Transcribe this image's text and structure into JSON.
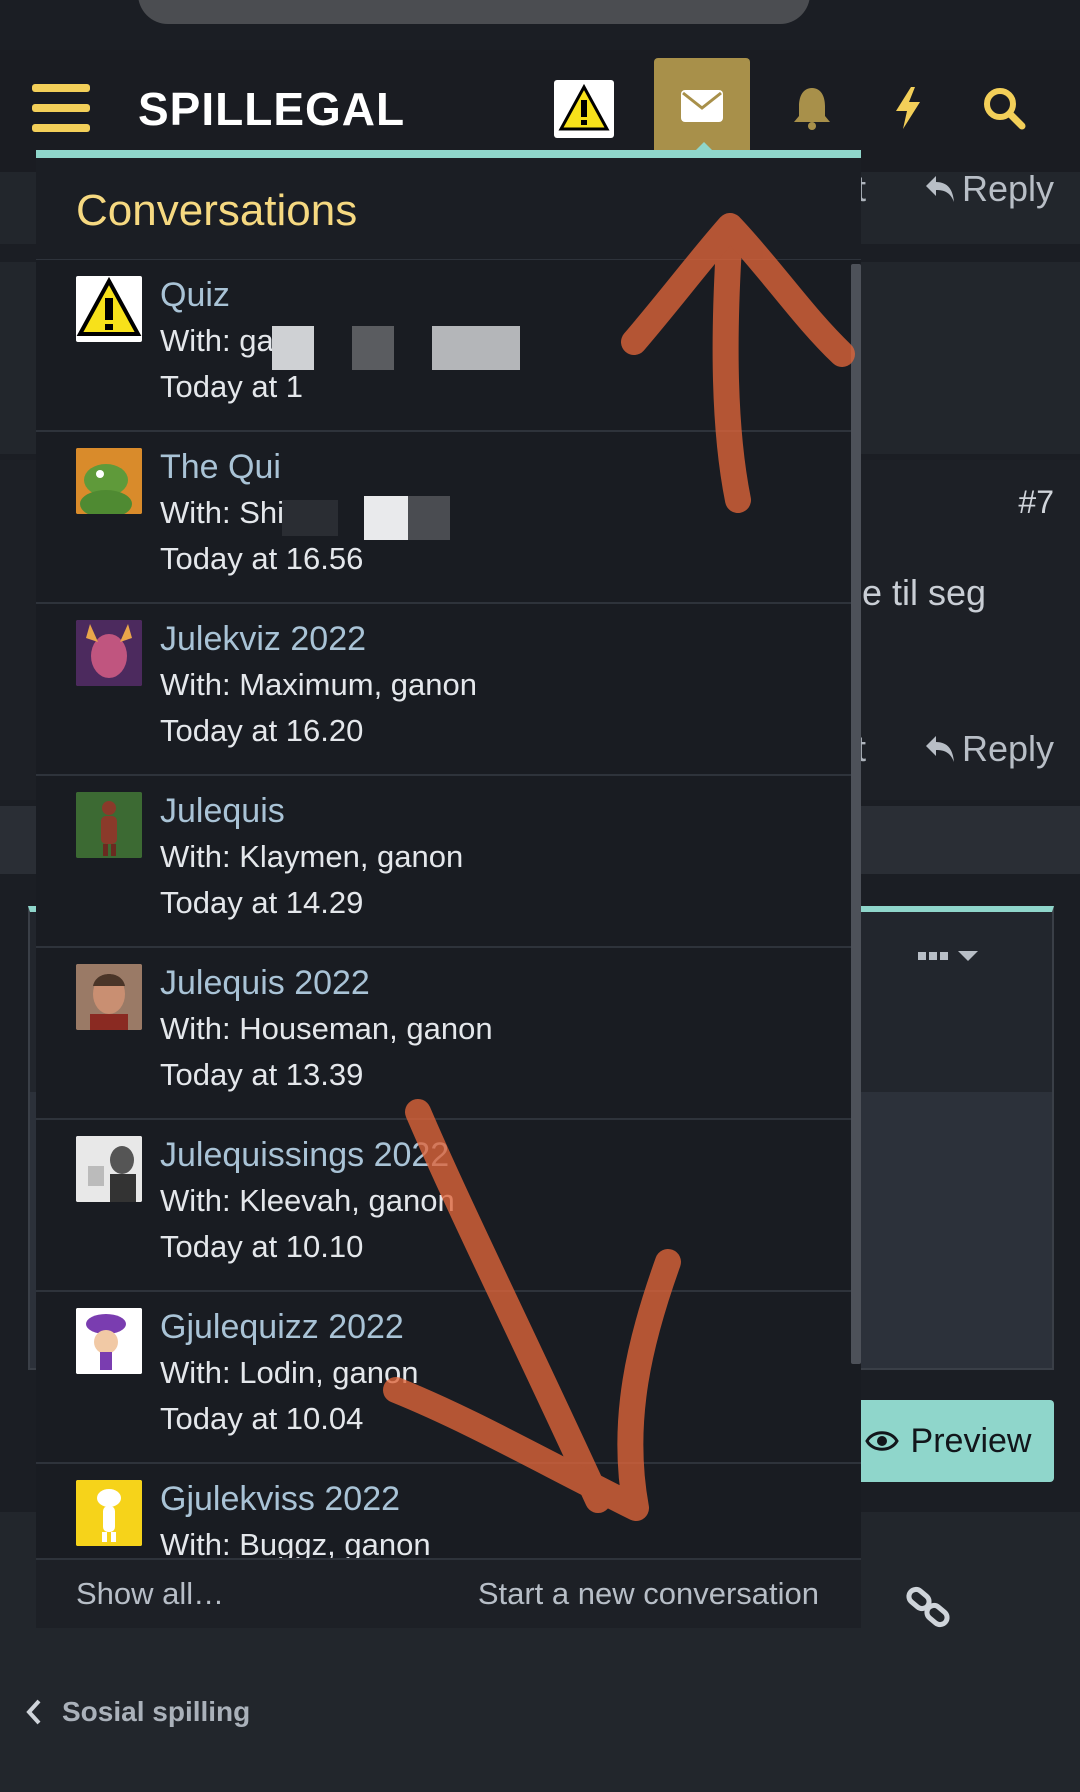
{
  "header": {
    "brand": "SPILLEGAL",
    "icons": [
      "menu-icon",
      "avatar-warning",
      "envelope-icon",
      "bell-icon",
      "bolt-icon",
      "search-icon"
    ],
    "accent_color": "#f3cf59",
    "active_tab_color": "#a8904a"
  },
  "background_page": {
    "reply_label": "Reply",
    "post_number": "#7",
    "body_fragment": "e til seg",
    "partial_text_1": "st",
    "partial_text_2": "st",
    "preview_label": "Preview",
    "breadcrumb": "Sosial spilling"
  },
  "popup": {
    "title": "Conversations",
    "conversations": [
      {
        "title": "Quiz",
        "with": "With: ga",
        "date": "Today at 1",
        "avatar": "warning-avatar"
      },
      {
        "title": "The Qui",
        "with": "With: Shi",
        "date": "Today at 16.56",
        "avatar": "green-creature-avatar"
      },
      {
        "title": "Julekviz 2022",
        "with": "With: Maximum, ganon",
        "date": "Today at 16.20",
        "avatar": "demon-avatar"
      },
      {
        "title": "Julequis",
        "with": "With: Klaymen, ganon",
        "date": "Today at 14.29",
        "avatar": "figure-avatar"
      },
      {
        "title": "Julequis 2022",
        "with": "With: Houseman, ganon",
        "date": "Today at 13.39",
        "avatar": "man-avatar"
      },
      {
        "title": "Julequissings 2022",
        "with": "With: Kleevah, ganon",
        "date": "Today at 10.10",
        "avatar": "mono-photo-avatar"
      },
      {
        "title": "Gjulequizz 2022",
        "with": "With: Lodin, ganon",
        "date": "Today at 10.04",
        "avatar": "purple-character-avatar"
      },
      {
        "title": "Gjulekviss 2022",
        "with": "With: Buggz, ganon",
        "date": "",
        "avatar": "yellow-cartoon-avatar"
      }
    ],
    "footer": {
      "show_all": "Show all…",
      "start_new": "Start a new conversation"
    }
  }
}
